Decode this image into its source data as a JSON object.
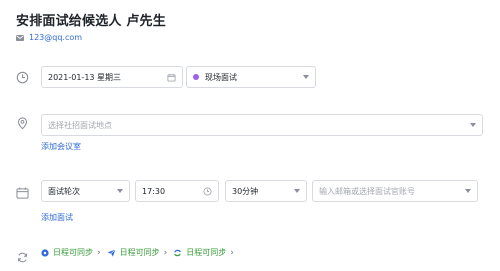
{
  "header": {
    "title": "安排面试给候选人 卢先生",
    "email": "123@qq.com"
  },
  "schedule": {
    "date_value": "2021-01-13 星期三",
    "type_value": "现场面试",
    "type_dot_color": "#9a63e8"
  },
  "location": {
    "placeholder": "选择社招面试地点",
    "add_room_label": "添加会议室"
  },
  "interview": {
    "round_value": "面试轮次",
    "time_value": "17:30",
    "duration_value": "30分钟",
    "interviewer_placeholder": "输入邮箱或选择面试官账号",
    "add_interview_label": "添加面试"
  },
  "sync": {
    "items": [
      {
        "label": "日程可同步",
        "icon": "calendar-sync-icon"
      },
      {
        "label": "日程可同步",
        "icon": "feishu-bird-icon"
      },
      {
        "label": "日程可同步",
        "icon": "cloud-sync-icon"
      }
    ],
    "colors": {
      "link": "#2f6ad8",
      "sync": "#3a9b3a"
    }
  }
}
